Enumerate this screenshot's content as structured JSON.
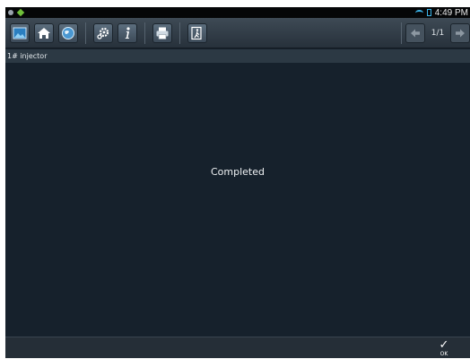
{
  "status_bar": {
    "time": "4:49 PM"
  },
  "toolbar": {
    "icons": [
      "picture-icon",
      "home-icon",
      "globe-icon",
      "settings-icon",
      "info-icon",
      "print-icon",
      "exit-icon"
    ],
    "page_indicator": "1/1"
  },
  "title": "1# injector",
  "content": {
    "message": "Completed"
  },
  "bottom": {
    "ok_label": "OK"
  },
  "colors": {
    "background": "#16212c",
    "toolbar": "#333e49",
    "titlebar": "#2c3944",
    "accent": "#3ab3e8"
  }
}
